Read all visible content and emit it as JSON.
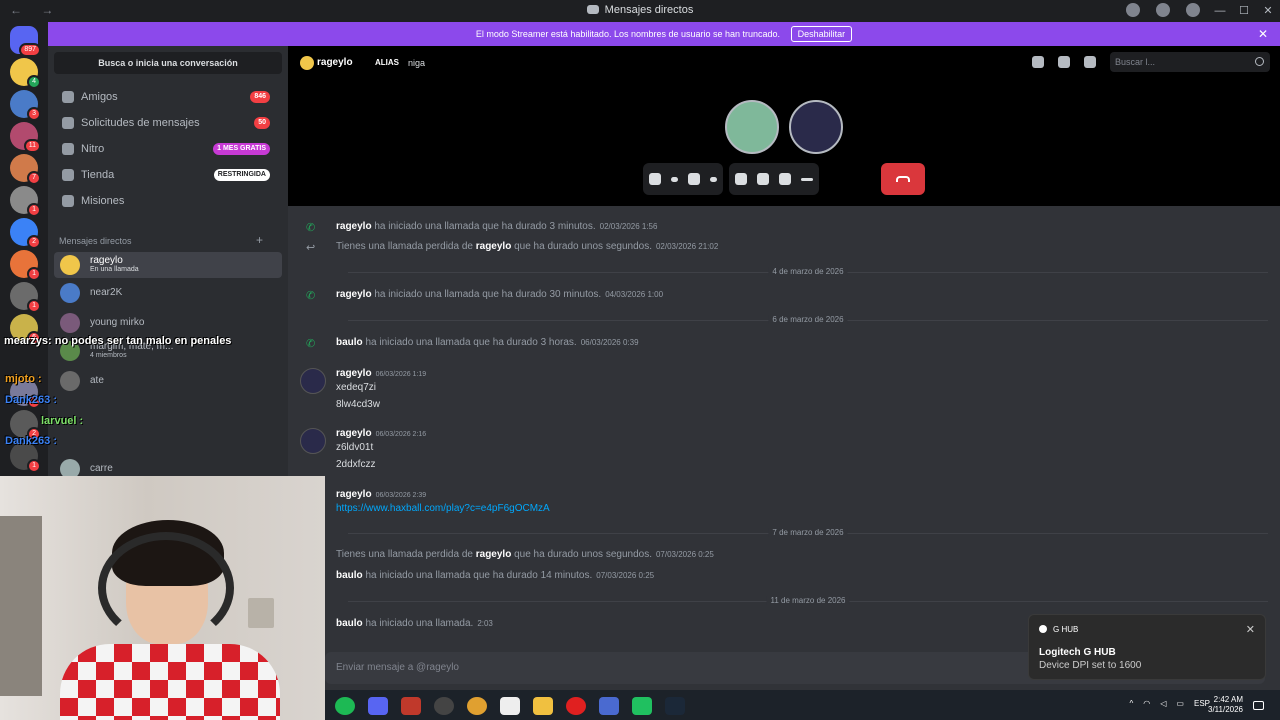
{
  "titlebar": {
    "title": "Mensajes directos",
    "nav": "← →"
  },
  "streamer": {
    "text": "El modo Streamer está habilitado. Los nombres de usuario se han truncado.",
    "button": "Deshabilitar"
  },
  "guild_badges": [
    "897",
    "4",
    "3",
    "11",
    "7",
    "1",
    "2",
    "1",
    "1",
    "6",
    "1",
    "2",
    "1"
  ],
  "sidebar": {
    "search": "Busca o inicia una conversación",
    "items": [
      {
        "label": "Amigos",
        "pill": "846"
      },
      {
        "label": "Solicitudes de mensajes",
        "pill": "50"
      },
      {
        "label": "Nitro",
        "pill": "1 MES GRATIS"
      },
      {
        "label": "Tienda",
        "pill": "RESTRINGIDA"
      },
      {
        "label": "Misiones",
        "pill": ""
      }
    ],
    "dm_header": "Mensajes directos",
    "dms": [
      {
        "name": "rageylo",
        "sub": "En una llamada"
      },
      {
        "name": "near2K",
        "sub": ""
      },
      {
        "name": "young mirko",
        "sub": ""
      },
      {
        "name": "margim, mate, m...",
        "sub": "4 miembros"
      },
      {
        "name": "ate",
        "sub": ""
      },
      {
        "name": "carre",
        "sub": ""
      }
    ]
  },
  "overlay_chat": [
    {
      "user": "mearzys",
      "text": ": no podes ser tan malo en penales",
      "color": "#ffffff"
    },
    {
      "user": "mjoto",
      "text": " :",
      "color": "#f0a020"
    },
    {
      "user": "Dank263",
      "text": " :",
      "color": "#3b82f6"
    },
    {
      "user": "larvuel",
      "text": " :",
      "color": "#7ee06a"
    },
    {
      "user": "Dank263",
      "text": " :",
      "color": "#3b82f6"
    }
  ],
  "call": {
    "username": "rageylo",
    "alias_label": "ALIAS",
    "alias_value": "niga",
    "search_placeholder": "Buscar l..."
  },
  "messages": {
    "sys1": {
      "user": "rageylo",
      "text": " ha iniciado una llamada que ha durado 3 minutos.",
      "ts": "02/03/2026 1:56"
    },
    "sys2": {
      "pre": "Tienes una llamada perdida de ",
      "user": "rageylo",
      "text": " que ha durado unos segundos.",
      "ts": "02/03/2026 21:02"
    },
    "div1": "4 de marzo de 2026",
    "sys3": {
      "user": "rageylo",
      "text": " ha iniciado una llamada que ha durado 30 minutos.",
      "ts": "04/03/2026 1:00"
    },
    "div2": "6 de marzo de 2026",
    "sys4": {
      "user": "baulo",
      "text": " ha iniciado una llamada que ha durado 3 horas.",
      "ts": "06/03/2026 0:39"
    },
    "m1": {
      "author": "rageylo",
      "ts": "06/03/2026 1:19",
      "l1": "xedeq7zi",
      "l2": "8lw4cd3w"
    },
    "m2": {
      "author": "rageylo",
      "ts": "06/03/2026 2:16",
      "l1": "z6ldv01t",
      "l2": "2ddxfczz"
    },
    "m3": {
      "author": "rageylo",
      "ts": "06/03/2026 2:39",
      "link": "https://www.haxball.com/play?c=e4pF6gOCMzA"
    },
    "div3": "7 de marzo de 2026",
    "sys5": {
      "pre": "Tienes una llamada perdida de ",
      "user": "rageylo",
      "text": " que ha durado unos segundos.",
      "ts": "07/03/2026 0:25"
    },
    "sys6": {
      "user": "baulo",
      "text": " ha iniciado una llamada que ha durado 14 minutos.",
      "ts": "07/03/2026 0:25"
    },
    "div4": "11 de marzo de 2026",
    "sys7": {
      "user": "baulo",
      "text": " ha iniciado una llamada.",
      "ts": "2:03"
    }
  },
  "composer": {
    "placeholder": "Enviar mensaje a @rageylo"
  },
  "toast": {
    "app": "G HUB",
    "title": "Logitech G HUB",
    "body": "Device DPI set to 1600"
  },
  "taskbar": {
    "lang": "ESP",
    "time": "2:42 AM",
    "date": "3/11/2026"
  }
}
